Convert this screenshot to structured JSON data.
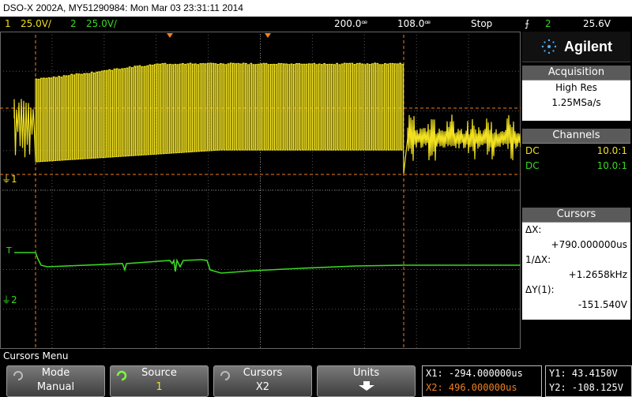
{
  "title": "DSO-X 2002A, MY51290984: Mon Mar 03 23:31:11 2014",
  "status": {
    "ch1_num": "1",
    "ch1_scale": "25.0V/",
    "ch2_num": "2",
    "ch2_scale": "25.0V/",
    "timebase": "200.0ꟹ",
    "delay": "108.0ꟹ",
    "run_state": "Stop",
    "trigger_icon": "trigger-edge-icon",
    "trigger_ch": "2",
    "trigger_level": "25.6V"
  },
  "brand": "Agilent",
  "acquisition": {
    "header": "Acquisition",
    "mode": "High Res",
    "rate": "1.25MSa/s"
  },
  "channels": {
    "header": "Channels",
    "ch1_coupling": "DC",
    "ch1_probe": "10.0:1",
    "ch2_coupling": "DC",
    "ch2_probe": "10.0:1"
  },
  "cursors": {
    "header": "Cursors",
    "dx_label": "ΔX:",
    "dx_value": "+790.000000us",
    "inv_dx_label": "1/ΔX:",
    "inv_dx_value": "+1.2658kHz",
    "dy_label": "ΔY(1):",
    "dy_value": "-151.540V"
  },
  "screen_markers": {
    "ch1_marker": "1",
    "ch2_marker": "2",
    "trig_marker": "T"
  },
  "menu_title": "Cursors Menu",
  "softkeys": [
    {
      "top": "Mode",
      "bottom": "Manual"
    },
    {
      "top": "Source",
      "bottom": "1"
    },
    {
      "top": "Cursors",
      "bottom": "X2"
    },
    {
      "top": "Units",
      "bottom": ""
    }
  ],
  "readout": {
    "x1": "X1: -294.000000us",
    "x2": "X2: 496.000000us",
    "y1": "Y1: 43.4150V",
    "y2": "Y2: -108.125V"
  },
  "colors": {
    "ch1": "#f0e020",
    "ch2": "#39d821",
    "cursor": "#f08020",
    "grid": "#555555"
  }
}
